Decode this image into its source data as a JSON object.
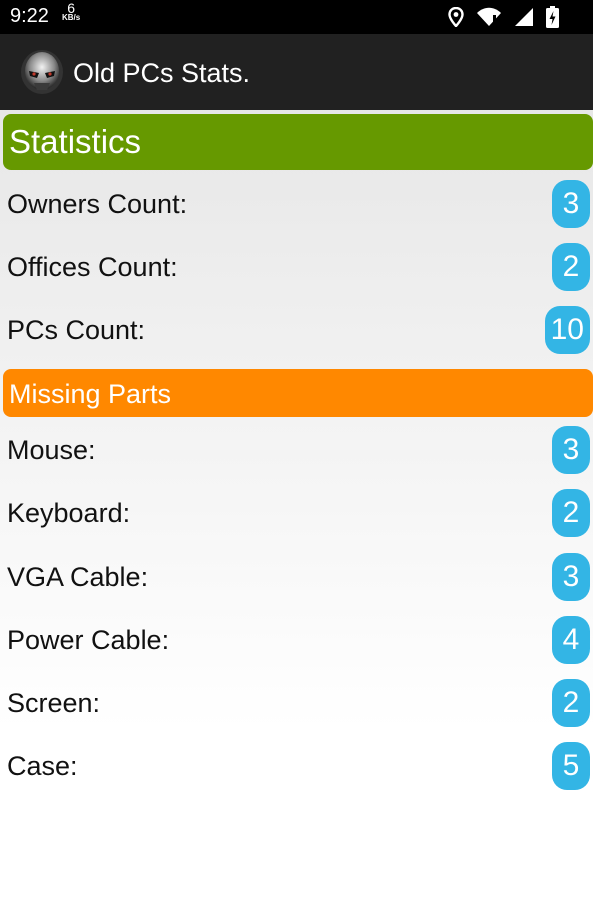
{
  "status_bar": {
    "time": "9:22",
    "net_speed": "6",
    "net_unit": "KB/s",
    "icons": [
      "location-icon",
      "wifi-icon",
      "cell-signal-icon",
      "battery-charging-icon"
    ]
  },
  "app_bar": {
    "title": "Old PCs Stats.",
    "icon": "app-logo-icon"
  },
  "sections": {
    "statistics": {
      "title": "Statistics",
      "color": "#669900",
      "rows": [
        {
          "label": "Owners Count:",
          "value": "3"
        },
        {
          "label": "Offices Count:",
          "value": "2"
        },
        {
          "label": "PCs Count:",
          "value": "10"
        }
      ]
    },
    "missing_parts": {
      "title": "Missing Parts",
      "color": "#ff8800",
      "rows": [
        {
          "label": "Mouse:",
          "value": "3"
        },
        {
          "label": "Keyboard:",
          "value": "2"
        },
        {
          "label": "VGA Cable:",
          "value": "3"
        },
        {
          "label": "Power Cable:",
          "value": "4"
        },
        {
          "label": "Screen:",
          "value": "2"
        },
        {
          "label": "Case:",
          "value": "5"
        }
      ]
    }
  },
  "badge_color": "#33b5e5"
}
